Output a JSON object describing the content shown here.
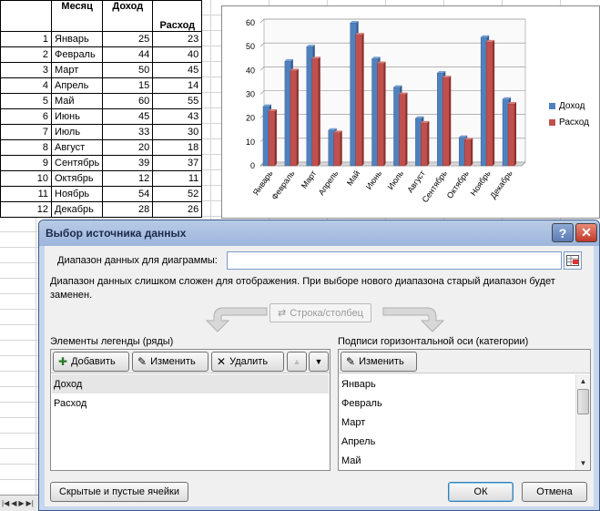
{
  "sheet": {
    "headers": {
      "month": "Месяц",
      "income": "Доход",
      "expense": "Расход"
    },
    "rows": [
      {
        "n": "1",
        "month": "Январь",
        "income": "25",
        "expense": "23"
      },
      {
        "n": "2",
        "month": "Февраль",
        "income": "44",
        "expense": "40"
      },
      {
        "n": "3",
        "month": "Март",
        "income": "50",
        "expense": "45"
      },
      {
        "n": "4",
        "month": "Апрель",
        "income": "15",
        "expense": "14"
      },
      {
        "n": "5",
        "month": "Май",
        "income": "60",
        "expense": "55"
      },
      {
        "n": "6",
        "month": "Июнь",
        "income": "45",
        "expense": "43"
      },
      {
        "n": "7",
        "month": "Июль",
        "income": "33",
        "expense": "30"
      },
      {
        "n": "8",
        "month": "Август",
        "income": "20",
        "expense": "18"
      },
      {
        "n": "9",
        "month": "Сентябрь",
        "income": "39",
        "expense": "37"
      },
      {
        "n": "10",
        "month": "Октябрь",
        "income": "12",
        "expense": "11"
      },
      {
        "n": "11",
        "month": "Ноябрь",
        "income": "54",
        "expense": "52"
      },
      {
        "n": "12",
        "month": "Декабрь",
        "income": "28",
        "expense": "26"
      }
    ]
  },
  "chart_data": {
    "type": "bar",
    "categories": [
      "Январь",
      "Февраль",
      "Март",
      "Апрель",
      "Май",
      "Июнь",
      "Июль",
      "Август",
      "Сентябрь",
      "Октябрь",
      "Ноябрь",
      "Декабрь"
    ],
    "series": [
      {
        "name": "Доход",
        "color": "#4f81bd",
        "values": [
          25,
          44,
          50,
          15,
          60,
          45,
          33,
          20,
          39,
          12,
          54,
          28
        ]
      },
      {
        "name": "Расход",
        "color": "#c0504d",
        "values": [
          23,
          40,
          45,
          14,
          55,
          43,
          30,
          18,
          37,
          11,
          52,
          26
        ]
      }
    ],
    "ylim": [
      0,
      60
    ],
    "yticks": [
      0,
      10,
      20,
      30,
      40,
      50,
      60
    ],
    "grid": true,
    "legend": "right"
  },
  "dialog": {
    "title": "Выбор источника данных",
    "help_label": "?",
    "close_label": "✕",
    "range_label": "Диапазон данных для диаграммы:",
    "range_value": "",
    "message": "Диапазон данных слишком сложен для отображения. При выборе нового диапазона старый диапазон будет заменен.",
    "switch_label": "Строка/столбец",
    "legend_panel": {
      "label": "Элементы легенды (ряды)",
      "add_label": "Добавить",
      "edit_label": "Изменить",
      "delete_label": "Удалить",
      "items": [
        "Доход",
        "Расход"
      ]
    },
    "axis_panel": {
      "label": "Подписи горизонтальной оси (категории)",
      "edit_label": "Изменить",
      "items": [
        "Январь",
        "Февраль",
        "Март",
        "Апрель",
        "Май"
      ]
    },
    "hidden_cells_label": "Скрытые и пустые ячейки",
    "ok_label": "ОК",
    "cancel_label": "Отмена"
  }
}
